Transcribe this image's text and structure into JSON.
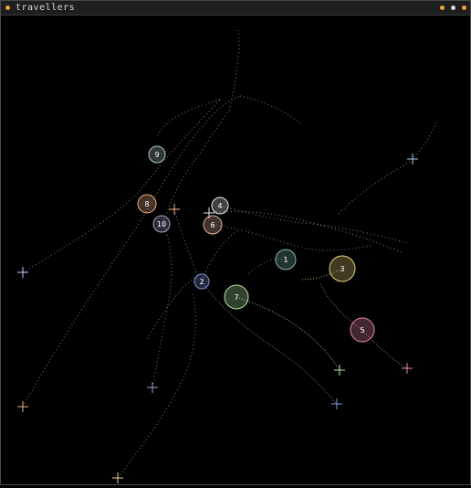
{
  "window": {
    "title": "travellers",
    "title_dot_color": "#e8a33b",
    "controls": [
      {
        "name": "minimize-button",
        "color": "#e8a33b"
      },
      {
        "name": "maximize-button",
        "color": "#d8d8d8"
      },
      {
        "name": "close-button",
        "color": "#e8a33b"
      }
    ]
  },
  "travellers": [
    {
      "label": "1",
      "color": "#7fb8b2"
    },
    {
      "label": "2",
      "color": "#7f93d6"
    },
    {
      "label": "3",
      "color": "#e8d27a"
    },
    {
      "label": "4",
      "color": "#e8e8e8"
    },
    {
      "label": "5",
      "color": "#e88ab2"
    },
    {
      "label": "6",
      "color": "#e8b2a0"
    },
    {
      "label": "7",
      "color": "#b8e8a8"
    },
    {
      "label": "8",
      "color": "#f0b080"
    },
    {
      "label": "9",
      "color": "#b0c8d0"
    },
    {
      "label": "10",
      "color": "#9ea0c8"
    }
  ]
}
